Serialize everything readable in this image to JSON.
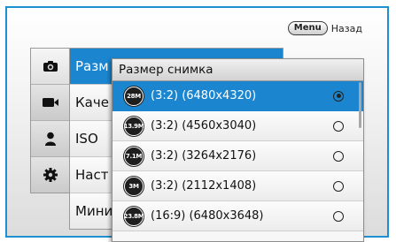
{
  "header": {
    "menu_key": "Menu",
    "back_label": "Назад"
  },
  "tabs": [
    {
      "icon": "camera-icon",
      "active": true
    },
    {
      "icon": "video-camera-icon",
      "active": false
    },
    {
      "icon": "person-icon",
      "active": false
    },
    {
      "icon": "gear-icon",
      "active": false
    }
  ],
  "menu_items": [
    {
      "label": "Разм",
      "selected": true
    },
    {
      "label": "Каче",
      "selected": false
    },
    {
      "label": "ISO",
      "selected": false
    },
    {
      "label": "Наст",
      "selected": false
    },
    {
      "label": "Мини",
      "selected": false
    }
  ],
  "popup": {
    "title": "Размер снимка",
    "options": [
      {
        "badge": "28M",
        "label": "(3:2) (6480x4320)",
        "selected": true
      },
      {
        "badge": "13.9M",
        "label": "(3:2) (4560x3040)",
        "selected": false
      },
      {
        "badge": "7.1M",
        "label": "(3:2) (3264x2176)",
        "selected": false
      },
      {
        "badge": "3M",
        "label": "(3:2) (2112x1408)",
        "selected": false
      },
      {
        "badge": "23.8M",
        "label": "(16:9) (6480x3648)",
        "selected": false
      }
    ]
  },
  "colors": {
    "accent": "#1b86cf",
    "frame": "#1e8fd0"
  }
}
